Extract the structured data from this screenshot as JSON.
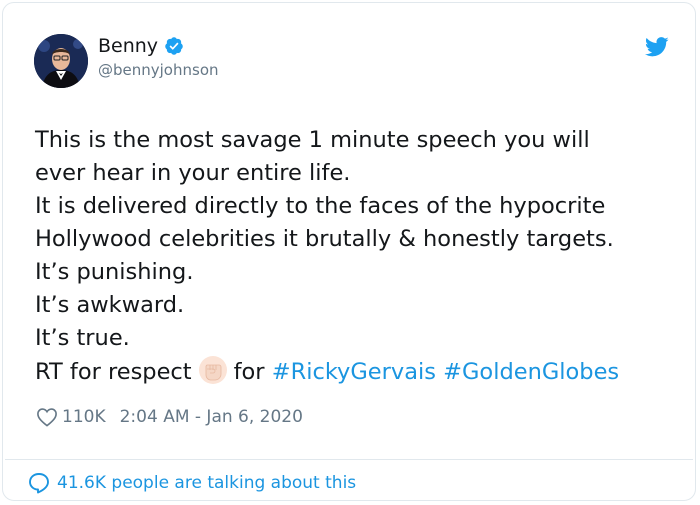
{
  "author": {
    "name": "Benny",
    "handle": "@bennyjohnson",
    "verified": true
  },
  "tweet": {
    "lines": [
      "This is the most savage 1 minute speech you will",
      "ever hear in your entire life.",
      "It is delivered directly to the faces of the hypocrite",
      "Hollywood celebrities it brutally & honestly targets.",
      "It’s punishing.",
      "It’s awkward.",
      "It’s true."
    ],
    "rt_line": {
      "prefix": "RT for respect",
      "emoji": "raised-fist-emoji",
      "middle": "for",
      "hashtag1": "#RickyGervais",
      "hashtag2": "#GoldenGlobes"
    }
  },
  "meta": {
    "likes": "110K",
    "timestamp": "2:04 AM - Jan 6, 2020"
  },
  "footer": {
    "talking": "41.6K people are talking about this"
  },
  "colors": {
    "link": "#1b95e0",
    "muted": "#657786",
    "text": "#14171a",
    "verified": "#1da1f2"
  },
  "icons": [
    "twitter-bird-icon",
    "verified-badge-icon",
    "heart-icon",
    "speech-bubble-icon"
  ]
}
